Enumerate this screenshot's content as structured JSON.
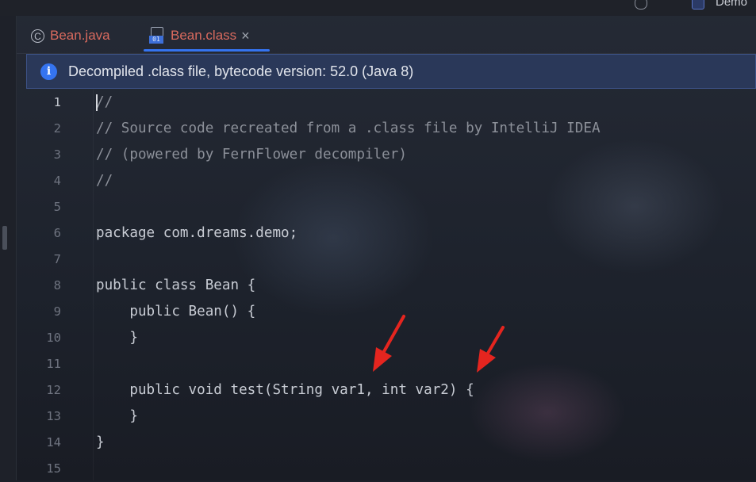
{
  "topbar": {
    "project_label": "Demo"
  },
  "tabs": [
    {
      "label": "Bean.java",
      "icon": "java-class-icon"
    },
    {
      "label": "Bean.class",
      "icon": "class-file-icon",
      "class_icon_text": "01",
      "close": "×"
    }
  ],
  "banner": {
    "icon": "ⓘ",
    "text": "Decompiled .class file, bytecode version: 52.0 (Java 8)"
  },
  "editor": {
    "line_numbers": [
      "1",
      "2",
      "3",
      "4",
      "5",
      "6",
      "7",
      "8",
      "9",
      "10",
      "11",
      "12",
      "13",
      "14",
      "15"
    ],
    "lines": [
      "//",
      "// Source code recreated from a .class file by IntelliJ IDEA",
      "// (powered by FernFlower decompiler)",
      "//",
      "",
      "package com.dreams.demo;",
      "",
      "public class Bean {",
      "    public Bean() {",
      "    }",
      "",
      "    public void test(String var1, int var2) {",
      "    }",
      "}",
      ""
    ]
  },
  "colors": {
    "tab_text": "#d96a5e",
    "accent": "#3574f0",
    "comment": "#8c9099",
    "code": "#c8ccd4",
    "arrow": "#e5251f"
  }
}
